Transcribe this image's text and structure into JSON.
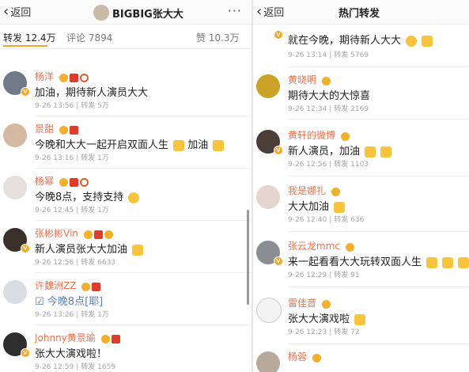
{
  "left": {
    "back_label": "返回",
    "title": "BIGBIG张大大",
    "more_label": "···",
    "tabs": {
      "repost": "转发 12.4万",
      "comment": "评论 7894",
      "like": "赞 10.3万"
    },
    "posts": [
      {
        "name": "杨洋",
        "text": "加油，期待新人演员大大",
        "time": "9-26 13:56",
        "repost": "转发 5万"
      },
      {
        "name": "景甜",
        "text": "今晚和大大一起开启双面人生",
        "tail": "加油",
        "time": "9-26 13:16",
        "repost": "转发 1万"
      },
      {
        "name": "杨幂",
        "text": "今晚8点，支持支持",
        "time": "9-26 12:45",
        "repost": "转发 1万"
      },
      {
        "name": "张彬彬Vin",
        "text": "新人演员张大大加油",
        "time": "9-26 12:56",
        "repost": "转发 6633"
      },
      {
        "name": "许魏洲ZZ",
        "text": "今晚8点[耶]",
        "time": "9-26 13:26",
        "repost": "转发 1万"
      },
      {
        "name": "Johnny黄景瑜",
        "text": "张大大演戏啦！",
        "time": "9-26 12:59",
        "repost": "转发 1659"
      }
    ]
  },
  "right": {
    "back_label": "返回",
    "title": "热门转发",
    "posts": [
      {
        "name": "",
        "text": "就在今晚，期待新人大大",
        "time": "9-26 13:14",
        "repost": "转发 5769"
      },
      {
        "name": "黄晓明",
        "text": "期待大大的大惊喜",
        "time": "9-26 12:34",
        "repost": "转发 2169"
      },
      {
        "name": "黄轩的微博",
        "text": "新人演员，加油",
        "time": "9-26 12:56",
        "repost": "转发 1103"
      },
      {
        "name": "我是娜扎",
        "text": "大大加油",
        "time": "9-26 12:40",
        "repost": "转发 636"
      },
      {
        "name": "张云龙mmc",
        "text": "来一起看看大大玩转双面人生",
        "time": "9-26 12:29",
        "repost": "转发 91"
      },
      {
        "name": "雷佳音",
        "text": "张大大演戏啦",
        "time": "9-26 12:23",
        "repost": "转发 72"
      },
      {
        "name": "杨蓉",
        "text": "",
        "time": "",
        "repost": ""
      }
    ]
  },
  "colors": {
    "username": "#eb7350",
    "link": "#5a7fb8",
    "accent": "#f3a22a"
  }
}
